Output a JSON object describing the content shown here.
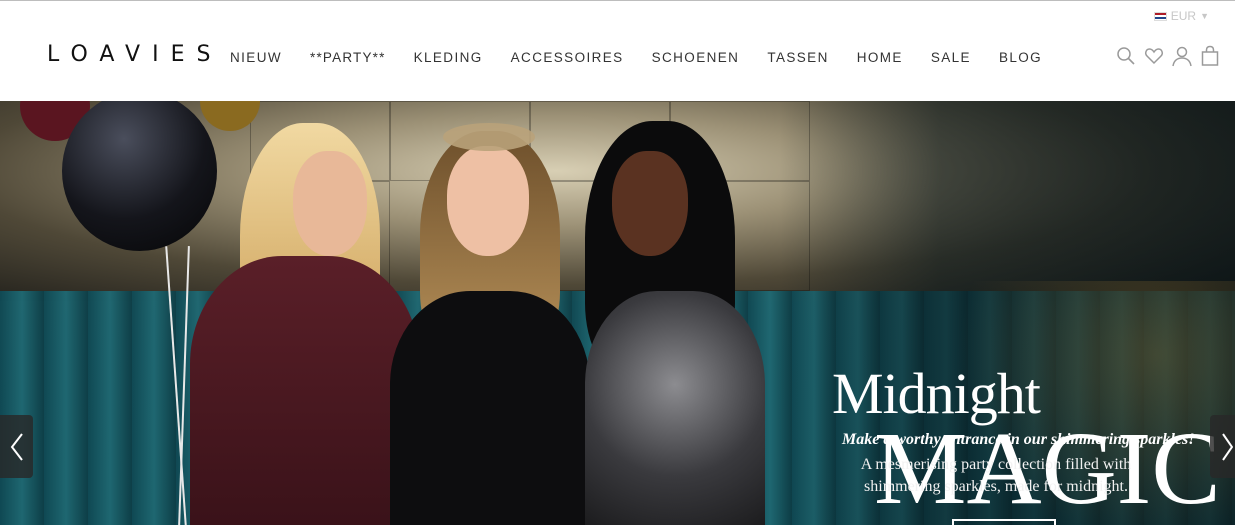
{
  "header": {
    "logo": "LOAVIES",
    "currency": "EUR",
    "nav": [
      "NIEUW",
      "**PARTY**",
      "KLEDING",
      "ACCESSOIRES",
      "SCHOENEN",
      "TASSEN",
      "HOME",
      "SALE",
      "BLOG"
    ],
    "icons": [
      "search-icon",
      "heart-icon",
      "user-icon",
      "bag-icon"
    ]
  },
  "hero": {
    "title_line1": "Midnight",
    "title_line2": "MAGIC",
    "tagline": "Make a worthy entrance in our shimmering sparkles!",
    "subline_1": "A mesmerising party collection filled with",
    "subline_2": "shimmering sparkles, made for midnight."
  },
  "carousel": {
    "prev_icon": "chevron-left-icon",
    "next_icon": "chevron-right-icon"
  },
  "colors": {
    "hero_text": "#ffffff",
    "booth_teal": "#0f4a55",
    "nav_text": "#333333"
  }
}
